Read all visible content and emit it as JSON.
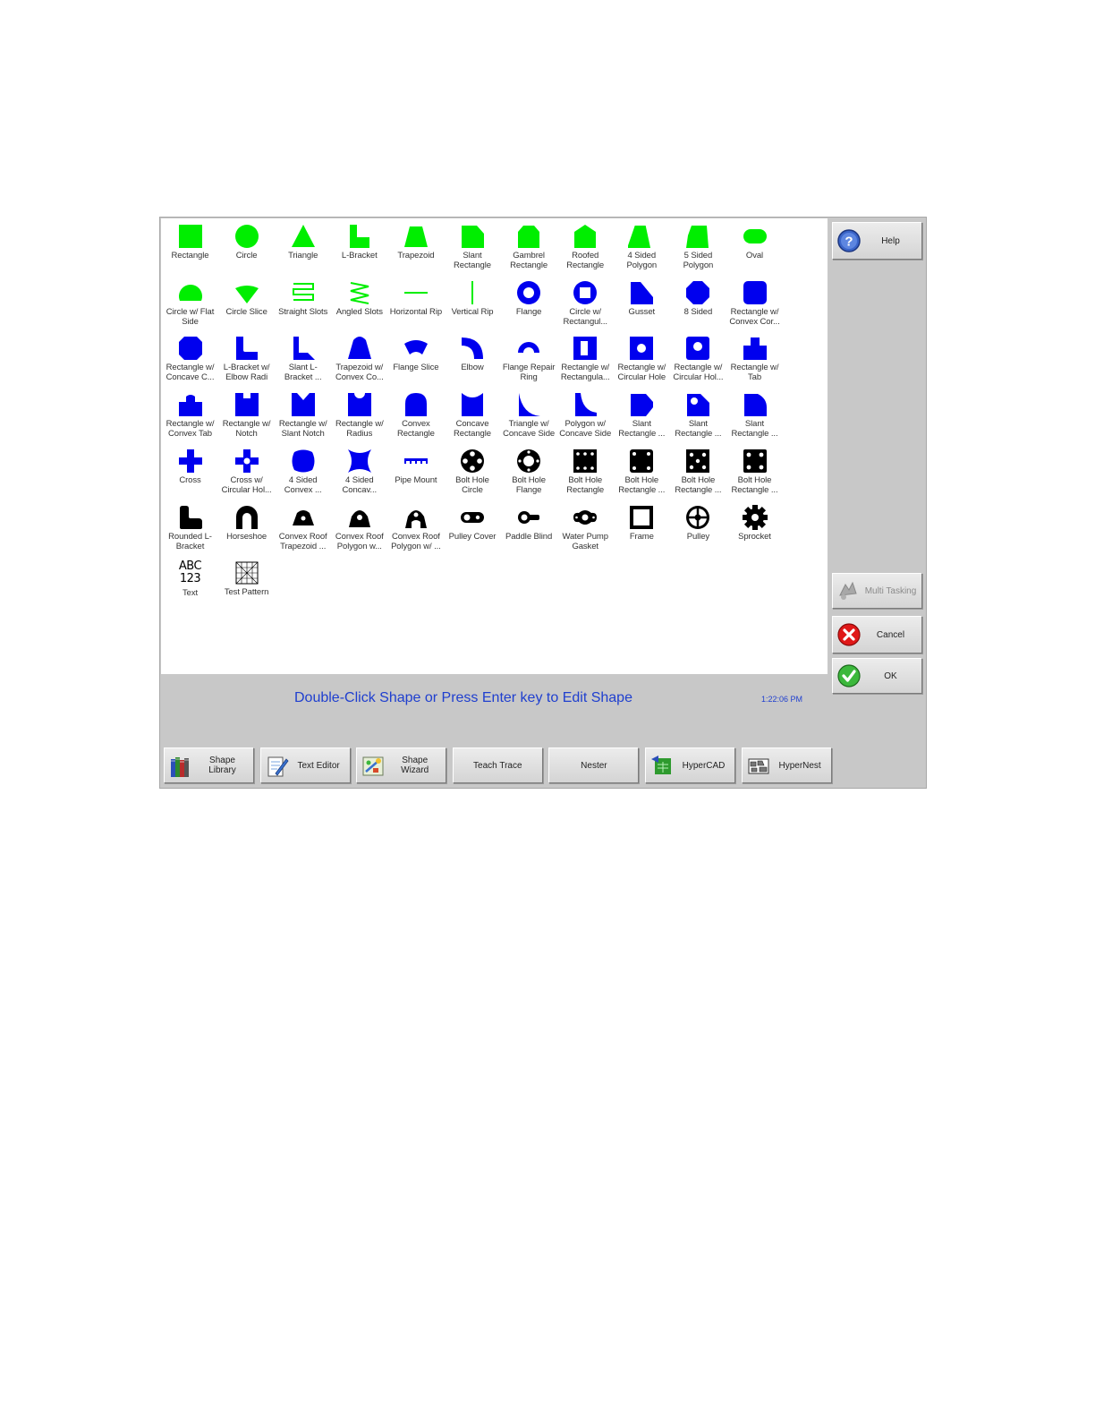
{
  "colors": {
    "green": "#00ee00",
    "blue": "#0000ee",
    "black": "#000000",
    "status_text": "#1f3fcf"
  },
  "shapes": [
    {
      "label": "Rectangle",
      "color": "green",
      "icon": "rectangle-icon"
    },
    {
      "label": "Circle",
      "color": "green",
      "icon": "circle-icon"
    },
    {
      "label": "Triangle",
      "color": "green",
      "icon": "triangle-icon"
    },
    {
      "label": "L-Bracket",
      "color": "green",
      "icon": "l-bracket-icon"
    },
    {
      "label": "Trapezoid",
      "color": "green",
      "icon": "trapezoid-icon"
    },
    {
      "label": "Slant Rectangle",
      "color": "green",
      "icon": "slant-rectangle-icon"
    },
    {
      "label": "Gambrel Rectangle",
      "color": "green",
      "icon": "gambrel-rectangle-icon"
    },
    {
      "label": "Roofed Rectangle",
      "color": "green",
      "icon": "roofed-rectangle-icon"
    },
    {
      "label": "4 Sided Polygon",
      "color": "green",
      "icon": "four-sided-polygon-icon"
    },
    {
      "label": "5 Sided Polygon",
      "color": "green",
      "icon": "five-sided-polygon-icon"
    },
    {
      "label": "Oval",
      "color": "green",
      "icon": "oval-icon"
    },
    {
      "label": "Circle w/ Flat Side",
      "color": "green",
      "icon": "circle-flat-side-icon"
    },
    {
      "label": "Circle Slice",
      "color": "green",
      "icon": "circle-slice-icon"
    },
    {
      "label": "Straight Slots",
      "color": "green",
      "icon": "straight-slots-icon"
    },
    {
      "label": "Angled Slots",
      "color": "green",
      "icon": "angled-slots-icon"
    },
    {
      "label": "Horizontal Rip",
      "color": "green",
      "icon": "horizontal-rip-icon"
    },
    {
      "label": "Vertical Rip",
      "color": "green",
      "icon": "vertical-rip-icon"
    },
    {
      "label": "Flange",
      "color": "blue",
      "icon": "flange-icon"
    },
    {
      "label": "Circle w/ Rectangul...",
      "color": "blue",
      "icon": "circle-rect-hole-icon"
    },
    {
      "label": "Gusset",
      "color": "blue",
      "icon": "gusset-icon"
    },
    {
      "label": "8 Sided",
      "color": "blue",
      "icon": "eight-sided-icon"
    },
    {
      "label": "Rectangle w/ Convex Cor...",
      "color": "blue",
      "icon": "rect-convex-corners-icon"
    },
    {
      "label": "Rectangle w/ Concave C...",
      "color": "blue",
      "icon": "rect-concave-corners-icon"
    },
    {
      "label": "L-Bracket w/ Elbow Radi",
      "color": "blue",
      "icon": "l-bracket-elbow-icon"
    },
    {
      "label": "Slant L-Bracket ...",
      "color": "blue",
      "icon": "slant-l-bracket-icon"
    },
    {
      "label": "Trapezoid w/ Convex Co...",
      "color": "blue",
      "icon": "trapezoid-convex-icon"
    },
    {
      "label": "Flange Slice",
      "color": "blue",
      "icon": "flange-slice-icon"
    },
    {
      "label": "Elbow",
      "color": "blue",
      "icon": "elbow-icon"
    },
    {
      "label": "Flange Repair Ring",
      "color": "blue",
      "icon": "flange-repair-ring-icon"
    },
    {
      "label": "Rectangle w/ Rectangula...",
      "color": "blue",
      "icon": "rect-rect-hole-icon"
    },
    {
      "label": "Rectangle w/ Circular Hole",
      "color": "blue",
      "icon": "rect-circular-hole-icon"
    },
    {
      "label": "Rectangle w/ Circular Hol...",
      "color": "blue",
      "icon": "rect-circular-hole-2-icon"
    },
    {
      "label": "Rectangle w/ Tab",
      "color": "blue",
      "icon": "rect-tab-icon"
    },
    {
      "label": "Rectangle w/ Convex Tab",
      "color": "blue",
      "icon": "rect-convex-tab-icon"
    },
    {
      "label": "Rectangle w/ Notch",
      "color": "blue",
      "icon": "rect-notch-icon"
    },
    {
      "label": "Rectangle w/ Slant Notch",
      "color": "blue",
      "icon": "rect-slant-notch-icon"
    },
    {
      "label": "Rectangle w/ Radius",
      "color": "blue",
      "icon": "rect-radius-icon"
    },
    {
      "label": "Convex Rectangle",
      "color": "blue",
      "icon": "convex-rectangle-icon"
    },
    {
      "label": "Concave Rectangle",
      "color": "blue",
      "icon": "concave-rectangle-icon"
    },
    {
      "label": "Triangle w/ Concave Side",
      "color": "blue",
      "icon": "triangle-concave-icon"
    },
    {
      "label": "Polygon w/ Concave Side",
      "color": "blue",
      "icon": "polygon-concave-icon"
    },
    {
      "label": "Slant Rectangle ...",
      "color": "blue",
      "icon": "slant-rect-2-icon"
    },
    {
      "label": "Slant Rectangle ...",
      "color": "blue",
      "icon": "slant-rect-3-icon"
    },
    {
      "label": "Slant Rectangle ...",
      "color": "blue",
      "icon": "slant-rect-4-icon"
    },
    {
      "label": "Cross",
      "color": "blue",
      "icon": "cross-icon"
    },
    {
      "label": "Cross w/ Circular Hol...",
      "color": "blue",
      "icon": "cross-hole-icon"
    },
    {
      "label": "4 Sided Convex ...",
      "color": "blue",
      "icon": "four-sided-convex-icon"
    },
    {
      "label": "4 Sided Concav...",
      "color": "blue",
      "icon": "four-sided-concave-icon"
    },
    {
      "label": "Pipe Mount",
      "color": "blue",
      "icon": "pipe-mount-icon"
    },
    {
      "label": "Bolt Hole Circle",
      "color": "black",
      "icon": "bolt-hole-circle-icon"
    },
    {
      "label": "Bolt Hole Flange",
      "color": "black",
      "icon": "bolt-hole-flange-icon"
    },
    {
      "label": "Bolt Hole Rectangle",
      "color": "black",
      "icon": "bolt-hole-rect-icon"
    },
    {
      "label": "Bolt Hole Rectangle ...",
      "color": "black",
      "icon": "bolt-hole-rect-2-icon"
    },
    {
      "label": "Bolt Hole Rectangle ...",
      "color": "black",
      "icon": "bolt-hole-rect-3-icon"
    },
    {
      "label": "Bolt Hole Rectangle ...",
      "color": "black",
      "icon": "bolt-hole-rect-4-icon"
    },
    {
      "label": "Rounded L-Bracket",
      "color": "black",
      "icon": "rounded-l-bracket-icon"
    },
    {
      "label": "Horseshoe",
      "color": "black",
      "icon": "horseshoe-icon"
    },
    {
      "label": "Convex Roof Trapezoid ...",
      "color": "black",
      "icon": "convex-roof-trapezoid-icon"
    },
    {
      "label": "Convex Roof Polygon w...",
      "color": "black",
      "icon": "convex-roof-polygon-icon"
    },
    {
      "label": "Convex Roof Polygon w/ ...",
      "color": "black",
      "icon": "convex-roof-polygon-2-icon"
    },
    {
      "label": "Pulley Cover",
      "color": "black",
      "icon": "pulley-cover-icon"
    },
    {
      "label": "Paddle Blind",
      "color": "black",
      "icon": "paddle-blind-icon"
    },
    {
      "label": "Water Pump Gasket",
      "color": "black",
      "icon": "water-pump-gasket-icon"
    },
    {
      "label": "Frame",
      "color": "black",
      "icon": "frame-icon"
    },
    {
      "label": "Pulley",
      "color": "black",
      "icon": "pulley-icon"
    },
    {
      "label": "Sprocket",
      "color": "black",
      "icon": "sprocket-icon"
    },
    {
      "label": "Text",
      "color": "black",
      "icon": "text-abc-icon"
    },
    {
      "label": "Test Pattern",
      "color": "black",
      "icon": "test-pattern-icon"
    }
  ],
  "text_icon": {
    "line1": "ABC",
    "line2": "123"
  },
  "status": {
    "message": "Double-Click Shape or Press Enter key to Edit Shape",
    "time": "1:22:06 PM"
  },
  "side_buttons": {
    "help": "Help",
    "multitasking": "Multi Tasking",
    "cancel": "Cancel",
    "ok": "OK"
  },
  "bottom_buttons": [
    {
      "label": "Shape Library",
      "icon": "book-library-icon"
    },
    {
      "label": "Text Editor",
      "icon": "notepad-pencil-icon"
    },
    {
      "label": "Shape Wizard",
      "icon": "wizard-icon"
    },
    {
      "label": "Teach Trace",
      "icon": ""
    },
    {
      "label": "Nester",
      "icon": ""
    },
    {
      "label": "HyperCAD",
      "icon": "hypercad-icon"
    },
    {
      "label": "HyperNest",
      "icon": "hypernest-icon"
    }
  ]
}
